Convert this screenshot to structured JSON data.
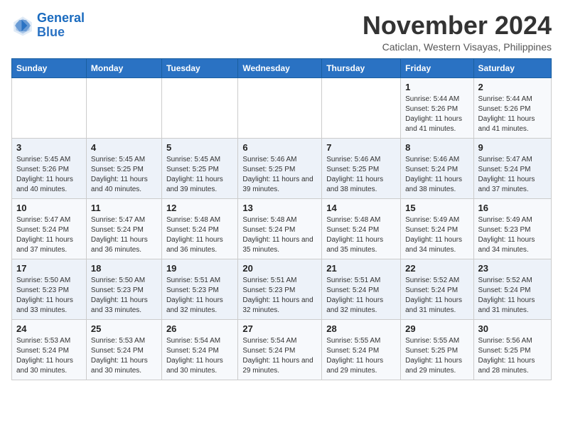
{
  "logo": {
    "line1": "General",
    "line2": "Blue"
  },
  "header": {
    "month": "November 2024",
    "location": "Caticlan, Western Visayas, Philippines"
  },
  "weekdays": [
    "Sunday",
    "Monday",
    "Tuesday",
    "Wednesday",
    "Thursday",
    "Friday",
    "Saturday"
  ],
  "weeks": [
    [
      {
        "day": "",
        "info": ""
      },
      {
        "day": "",
        "info": ""
      },
      {
        "day": "",
        "info": ""
      },
      {
        "day": "",
        "info": ""
      },
      {
        "day": "",
        "info": ""
      },
      {
        "day": "1",
        "info": "Sunrise: 5:44 AM\nSunset: 5:26 PM\nDaylight: 11 hours and 41 minutes."
      },
      {
        "day": "2",
        "info": "Sunrise: 5:44 AM\nSunset: 5:26 PM\nDaylight: 11 hours and 41 minutes."
      }
    ],
    [
      {
        "day": "3",
        "info": "Sunrise: 5:45 AM\nSunset: 5:26 PM\nDaylight: 11 hours and 40 minutes."
      },
      {
        "day": "4",
        "info": "Sunrise: 5:45 AM\nSunset: 5:25 PM\nDaylight: 11 hours and 40 minutes."
      },
      {
        "day": "5",
        "info": "Sunrise: 5:45 AM\nSunset: 5:25 PM\nDaylight: 11 hours and 39 minutes."
      },
      {
        "day": "6",
        "info": "Sunrise: 5:46 AM\nSunset: 5:25 PM\nDaylight: 11 hours and 39 minutes."
      },
      {
        "day": "7",
        "info": "Sunrise: 5:46 AM\nSunset: 5:25 PM\nDaylight: 11 hours and 38 minutes."
      },
      {
        "day": "8",
        "info": "Sunrise: 5:46 AM\nSunset: 5:24 PM\nDaylight: 11 hours and 38 minutes."
      },
      {
        "day": "9",
        "info": "Sunrise: 5:47 AM\nSunset: 5:24 PM\nDaylight: 11 hours and 37 minutes."
      }
    ],
    [
      {
        "day": "10",
        "info": "Sunrise: 5:47 AM\nSunset: 5:24 PM\nDaylight: 11 hours and 37 minutes."
      },
      {
        "day": "11",
        "info": "Sunrise: 5:47 AM\nSunset: 5:24 PM\nDaylight: 11 hours and 36 minutes."
      },
      {
        "day": "12",
        "info": "Sunrise: 5:48 AM\nSunset: 5:24 PM\nDaylight: 11 hours and 36 minutes."
      },
      {
        "day": "13",
        "info": "Sunrise: 5:48 AM\nSunset: 5:24 PM\nDaylight: 11 hours and 35 minutes."
      },
      {
        "day": "14",
        "info": "Sunrise: 5:48 AM\nSunset: 5:24 PM\nDaylight: 11 hours and 35 minutes."
      },
      {
        "day": "15",
        "info": "Sunrise: 5:49 AM\nSunset: 5:24 PM\nDaylight: 11 hours and 34 minutes."
      },
      {
        "day": "16",
        "info": "Sunrise: 5:49 AM\nSunset: 5:23 PM\nDaylight: 11 hours and 34 minutes."
      }
    ],
    [
      {
        "day": "17",
        "info": "Sunrise: 5:50 AM\nSunset: 5:23 PM\nDaylight: 11 hours and 33 minutes."
      },
      {
        "day": "18",
        "info": "Sunrise: 5:50 AM\nSunset: 5:23 PM\nDaylight: 11 hours and 33 minutes."
      },
      {
        "day": "19",
        "info": "Sunrise: 5:51 AM\nSunset: 5:23 PM\nDaylight: 11 hours and 32 minutes."
      },
      {
        "day": "20",
        "info": "Sunrise: 5:51 AM\nSunset: 5:23 PM\nDaylight: 11 hours and 32 minutes."
      },
      {
        "day": "21",
        "info": "Sunrise: 5:51 AM\nSunset: 5:24 PM\nDaylight: 11 hours and 32 minutes."
      },
      {
        "day": "22",
        "info": "Sunrise: 5:52 AM\nSunset: 5:24 PM\nDaylight: 11 hours and 31 minutes."
      },
      {
        "day": "23",
        "info": "Sunrise: 5:52 AM\nSunset: 5:24 PM\nDaylight: 11 hours and 31 minutes."
      }
    ],
    [
      {
        "day": "24",
        "info": "Sunrise: 5:53 AM\nSunset: 5:24 PM\nDaylight: 11 hours and 30 minutes."
      },
      {
        "day": "25",
        "info": "Sunrise: 5:53 AM\nSunset: 5:24 PM\nDaylight: 11 hours and 30 minutes."
      },
      {
        "day": "26",
        "info": "Sunrise: 5:54 AM\nSunset: 5:24 PM\nDaylight: 11 hours and 30 minutes."
      },
      {
        "day": "27",
        "info": "Sunrise: 5:54 AM\nSunset: 5:24 PM\nDaylight: 11 hours and 29 minutes."
      },
      {
        "day": "28",
        "info": "Sunrise: 5:55 AM\nSunset: 5:24 PM\nDaylight: 11 hours and 29 minutes."
      },
      {
        "day": "29",
        "info": "Sunrise: 5:55 AM\nSunset: 5:25 PM\nDaylight: 11 hours and 29 minutes."
      },
      {
        "day": "30",
        "info": "Sunrise: 5:56 AM\nSunset: 5:25 PM\nDaylight: 11 hours and 28 minutes."
      }
    ]
  ]
}
